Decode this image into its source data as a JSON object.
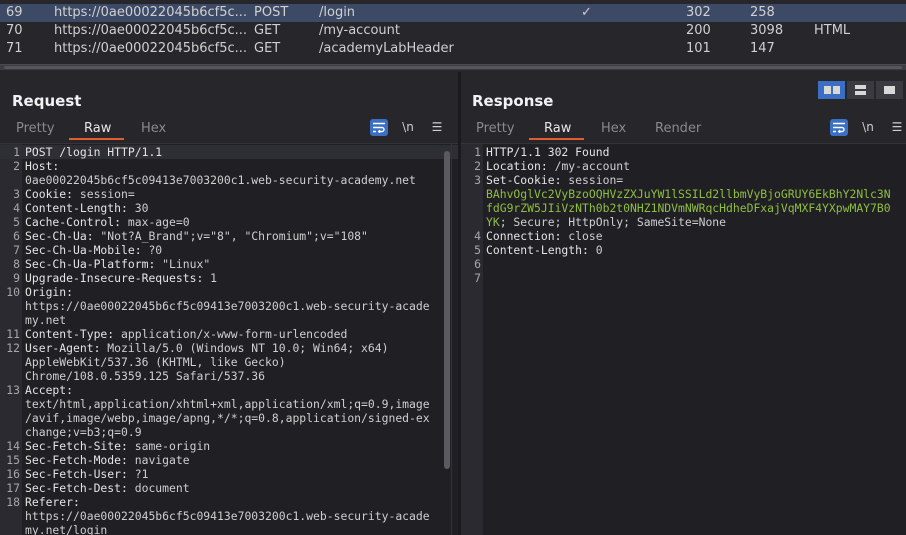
{
  "history": {
    "rows": [
      {
        "num": "69",
        "host": "https://0ae00022045b6cf5c...",
        "method": "POST",
        "url": "/login",
        "check": "✓",
        "status": "302",
        "length": "258",
        "mime": "",
        "selected": true
      },
      {
        "num": "70",
        "host": "https://0ae00022045b6cf5c...",
        "method": "GET",
        "url": "/my-account",
        "check": "",
        "status": "200",
        "length": "3098",
        "mime": "HTML",
        "selected": false
      },
      {
        "num": "71",
        "host": "https://0ae00022045b6cf5c...",
        "method": "GET",
        "url": "/academyLabHeader",
        "check": "",
        "status": "101",
        "length": "147",
        "mime": "",
        "selected": false
      }
    ]
  },
  "request": {
    "title": "Request",
    "tabs": [
      "Pretty",
      "Raw",
      "Hex"
    ],
    "active_tab": "Raw",
    "tools": {
      "newline": "\\n",
      "menu": "☰"
    },
    "lines": [
      {
        "n": "1",
        "k": "POST /login HTTP/1.1",
        "v": ""
      },
      {
        "n": "2",
        "k": "Host:",
        "v": ""
      },
      {
        "n": "",
        "k": "",
        "v": "0ae00022045b6cf5c09413e7003200c1.web-security-academy.net"
      },
      {
        "n": "3",
        "k": "Cookie:",
        "v": " session="
      },
      {
        "n": "4",
        "k": "Content-Length:",
        "v": " 30"
      },
      {
        "n": "5",
        "k": "Cache-Control:",
        "v": " max-age=0"
      },
      {
        "n": "6",
        "k": "Sec-Ch-Ua:",
        "v": " \"Not?A_Brand\";v=\"8\", \"Chromium\";v=\"108\""
      },
      {
        "n": "7",
        "k": "Sec-Ch-Ua-Mobile:",
        "v": " ?0"
      },
      {
        "n": "8",
        "k": "Sec-Ch-Ua-Platform:",
        "v": " \"Linux\""
      },
      {
        "n": "9",
        "k": "Upgrade-Insecure-Requests:",
        "v": " 1"
      },
      {
        "n": "10",
        "k": "Origin:",
        "v": ""
      },
      {
        "n": "",
        "k": "",
        "v": "https://0ae00022045b6cf5c09413e7003200c1.web-security-acade"
      },
      {
        "n": "",
        "k": "",
        "v": "my.net"
      },
      {
        "n": "11",
        "k": "Content-Type:",
        "v": " application/x-www-form-urlencoded"
      },
      {
        "n": "12",
        "k": "User-Agent:",
        "v": " Mozilla/5.0 (Windows NT 10.0; Win64; x64)"
      },
      {
        "n": "",
        "k": "",
        "v": "AppleWebKit/537.36 (KHTML, like Gecko)"
      },
      {
        "n": "",
        "k": "",
        "v": "Chrome/108.0.5359.125 Safari/537.36"
      },
      {
        "n": "13",
        "k": "Accept:",
        "v": ""
      },
      {
        "n": "",
        "k": "",
        "v": "text/html,application/xhtml+xml,application/xml;q=0.9,image"
      },
      {
        "n": "",
        "k": "",
        "v": "/avif,image/webp,image/apng,*/*;q=0.8,application/signed-ex"
      },
      {
        "n": "",
        "k": "",
        "v": "change;v=b3;q=0.9"
      },
      {
        "n": "14",
        "k": "Sec-Fetch-Site:",
        "v": " same-origin"
      },
      {
        "n": "15",
        "k": "Sec-Fetch-Mode:",
        "v": " navigate"
      },
      {
        "n": "16",
        "k": "Sec-Fetch-User:",
        "v": " ?1"
      },
      {
        "n": "17",
        "k": "Sec-Fetch-Dest:",
        "v": " document"
      },
      {
        "n": "18",
        "k": "Referer:",
        "v": ""
      },
      {
        "n": "",
        "k": "",
        "v": "https://0ae00022045b6cf5c09413e7003200c1.web-security-acade"
      },
      {
        "n": "",
        "k": "",
        "v": "my.net/login"
      }
    ]
  },
  "response": {
    "title": "Response",
    "tabs": [
      "Pretty",
      "Raw",
      "Hex",
      "Render"
    ],
    "active_tab": "Raw",
    "tools": {
      "newline": "\\n",
      "menu": "☰"
    },
    "lines": [
      {
        "n": "1",
        "k": "HTTP/1.1 302 Found",
        "v": "",
        "green": ""
      },
      {
        "n": "2",
        "k": "Location:",
        "v": " /my-account",
        "green": ""
      },
      {
        "n": "3",
        "k": "Set-Cookie:",
        "v": " session=",
        "green": ""
      },
      {
        "n": "",
        "k": "",
        "v": "",
        "green": "BAhvOglVc2VyBzoOQHVzZXJuYW1lSSILd2llbmVyBjoGRUY6EkBhY2Nlc3N"
      },
      {
        "n": "",
        "k": "",
        "v": "",
        "green": "fdG9rZW5JIiVzNTh0b2t0NHZ1NDVmNWRqcHdheDFxajVqMXF4YXpwMAY7B0"
      },
      {
        "n": "",
        "k": "",
        "v": "; Secure; HttpOnly; SameSite=None",
        "green": "YK"
      },
      {
        "n": "4",
        "k": "Connection:",
        "v": " close",
        "green": ""
      },
      {
        "n": "5",
        "k": "Content-Length:",
        "v": " 0",
        "green": ""
      },
      {
        "n": "6",
        "k": "",
        "v": "",
        "green": ""
      },
      {
        "n": "7",
        "k": "",
        "v": "",
        "green": ""
      }
    ]
  }
}
